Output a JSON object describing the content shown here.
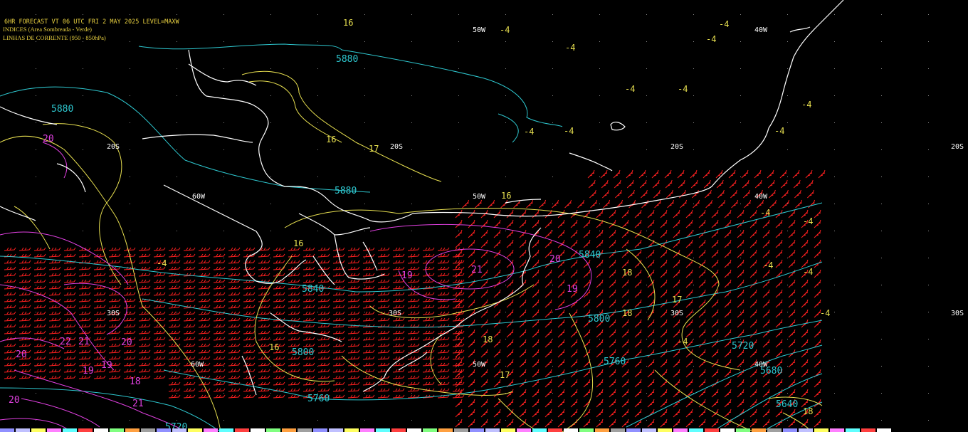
{
  "header": {
    "line1": "6HR FORECAST    VT 06 UTC FRI 2 MAY 2025    LEVEL=MAXW",
    "line2": "INDICES (Area Sombreada - Verde)",
    "line3": "LINHAS DE CORRENTE (950 - 850hPa)"
  },
  "colors": {
    "background": "#000000",
    "coast": "#ffffff",
    "geopotential": "#2ec8d0",
    "index_yellow": "#e8e050",
    "index_magenta": "#e040e0",
    "wind_barbs": "#ff2020",
    "header_text": "#e8d040"
  },
  "grid_labels": {
    "lon_50w": "50W",
    "lon_40w": "40W",
    "lon_60w": "60W",
    "lat_20s": "20S",
    "lat_30s": "30S"
  },
  "geopotential_labels": [
    "5880",
    "5880",
    "5880",
    "5840",
    "5840",
    "5800",
    "5800",
    "5760",
    "5760",
    "5720",
    "5720",
    "5680",
    "5640"
  ],
  "yellow_labels": [
    "16",
    "16",
    "16",
    "16",
    "16",
    "17",
    "17",
    "17",
    "18",
    "18",
    "18",
    "18",
    "-4",
    "-4",
    "-4",
    "-4",
    "-4",
    "-4",
    "-4",
    "-4",
    "-4",
    "-4",
    "-4",
    "-4",
    "-4",
    "-4",
    "-4",
    "-4",
    "-4"
  ],
  "magenta_labels": [
    "19",
    "21",
    "20",
    "19",
    "20",
    "21",
    "20",
    "19",
    "19",
    "20",
    "22",
    "21",
    "20",
    "18"
  ]
}
